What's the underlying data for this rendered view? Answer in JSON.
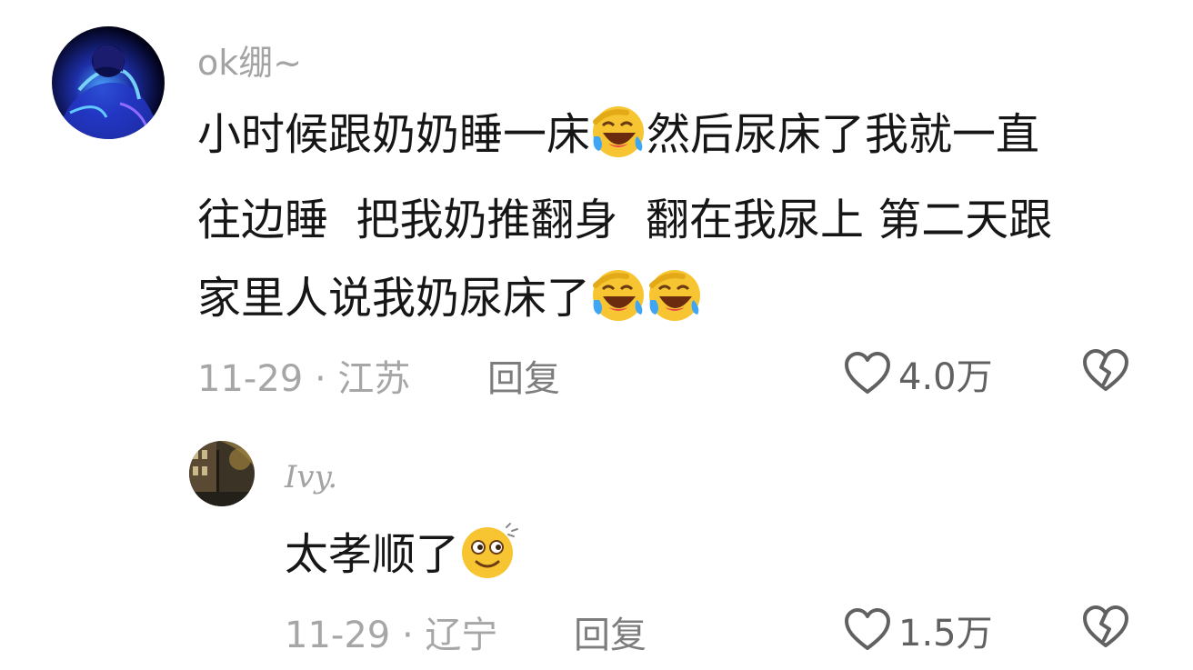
{
  "comments": [
    {
      "username": "ok绷~",
      "lines": [
        {
          "a": "小时候跟奶奶睡一床",
          "b": "然后尿床了我就一直"
        },
        {
          "a": "往边睡  把我奶推翻身  翻在我尿上 第二天跟"
        },
        {
          "a": "家里人说我奶尿床了"
        }
      ],
      "emojis": [
        "laughing-crying-emoji",
        "laughing-crying-emoji",
        "laughing-crying-emoji"
      ],
      "date": "11-29",
      "separator": "·",
      "location": "江苏",
      "reply_label": "回复",
      "like_count": "4.0万"
    },
    {
      "username": "Ivy.",
      "text": "太孝顺了",
      "emojis": [
        "dizzy-smile-emoji"
      ],
      "date": "11-29",
      "separator": "·",
      "location": "辽宁",
      "reply_label": "回复",
      "like_count": "1.5万"
    }
  ],
  "colors": {
    "text": "#161616",
    "username": "#a3a3a3",
    "meta": "#a6a6a6",
    "reply": "#7d7d7d",
    "icon": "#616161",
    "emoji_yellow": "#f7c531"
  }
}
